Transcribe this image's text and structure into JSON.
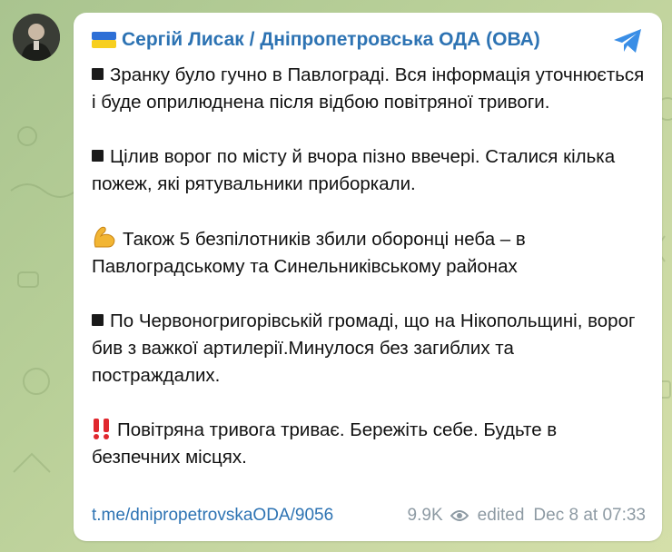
{
  "post": {
    "channel_name": "Сергій Лисак / Дніпропетровська ОДА (ОВА)",
    "paragraphs": [
      "Зранку було гучно в Павлограді. Вся інформація уточнюється і буде оприлюднена після відбою повітряної тривоги.",
      "Цілив ворог по місту й вчора пізно ввечері. Сталися кілька пожеж, які рятувальники приборкали.",
      "Також 5 безпілотників збили оборонці неба – в Павлоградському та Синельниківському районах",
      "По Червоногригорівській громаді, що на Нікопольщині, ворог бив з важкої артилерії.Минулося без загиблих та постраждалих.",
      "Повітряна тривога триває. Бережіть себе. Будьте в безпечних місцях."
    ],
    "link": "t.me/dnipropetrovskaODA/9056",
    "views": "9.9K",
    "edited_label": "edited",
    "timestamp": "Dec 8 at 07:33"
  },
  "icons": {
    "avatar": "avatar",
    "flag": "ukraine-flag-icon",
    "share": "telegram-share-icon",
    "bullet": "black-square-icon",
    "muscle": "flexed-biceps-icon",
    "exclamation": "double-exclamation-icon",
    "views": "eye-icon"
  },
  "colors": {
    "link": "#2d73b3",
    "meta": "#8d9aa3",
    "bubble": "#ffffff",
    "background": "#b8cf98"
  }
}
